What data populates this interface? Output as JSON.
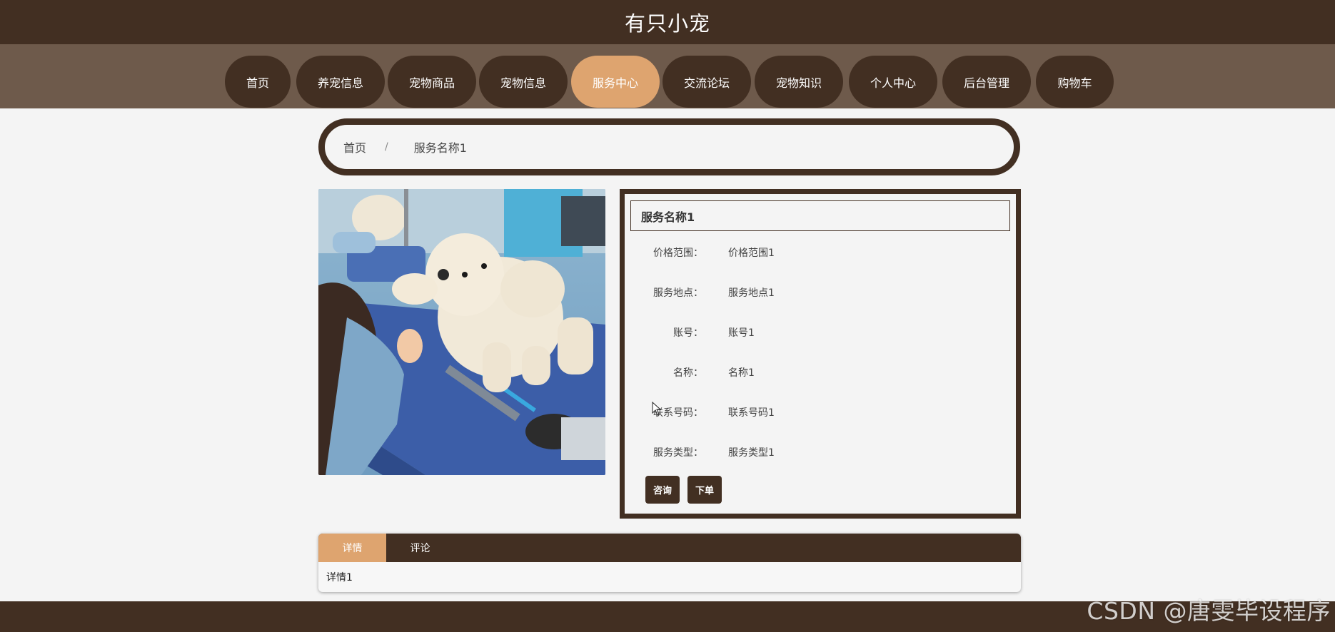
{
  "header": {
    "title": "有只小宠"
  },
  "nav": {
    "items": [
      {
        "label": "首页"
      },
      {
        "label": "养宠信息"
      },
      {
        "label": "宠物商品"
      },
      {
        "label": "宠物信息"
      },
      {
        "label": "服务中心",
        "active": true
      },
      {
        "label": "交流论坛"
      },
      {
        "label": "宠物知识"
      },
      {
        "label": "个人中心"
      },
      {
        "label": "后台管理"
      },
      {
        "label": "购物车"
      }
    ]
  },
  "breadcrumb": {
    "home": "首页",
    "separator": "/",
    "current": "服务名称1"
  },
  "detail": {
    "title": "服务名称1",
    "fields": [
      {
        "label": "价格范围：",
        "value": "价格范围1"
      },
      {
        "label": "服务地点：",
        "value": "服务地点1"
      },
      {
        "label": "账号：",
        "value": "账号1"
      },
      {
        "label": "名称：",
        "value": "名称1"
      },
      {
        "label": "联系号码：",
        "value": "联系号码1"
      },
      {
        "label": "服务类型：",
        "value": "服务类型1"
      }
    ],
    "buttons": {
      "consult": "咨询",
      "order": "下单"
    }
  },
  "tabs": {
    "items": [
      {
        "label": "详情",
        "active": true
      },
      {
        "label": "评论"
      }
    ],
    "content": "详情1"
  },
  "watermark": "CSDN @唐雯毕设程序",
  "colors": {
    "primary": "#422f22",
    "accent": "#dea46f",
    "nav_bg": "#6e5a4b",
    "page_bg": "#f4f4f4"
  }
}
